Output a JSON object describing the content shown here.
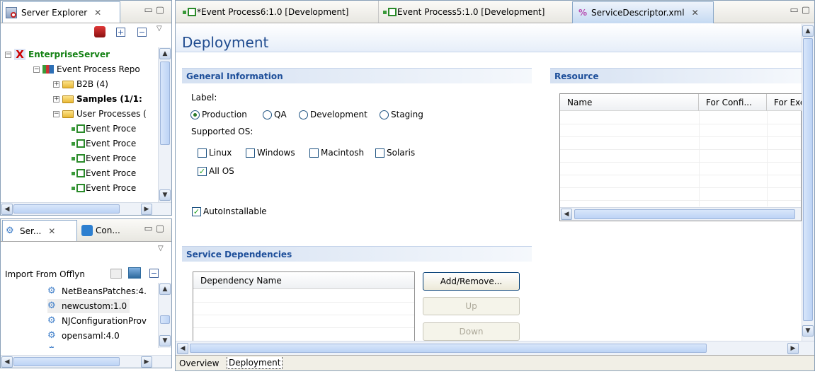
{
  "left_top_view": {
    "tab_label": "Server Explorer",
    "tree": [
      {
        "label": "EnterpriseServer",
        "kind": "server",
        "toggle": "−"
      },
      {
        "label": "Event Process Repo",
        "kind": "repo",
        "toggle": "−"
      },
      {
        "label": "B2B (4)",
        "kind": "folder",
        "toggle": "+"
      },
      {
        "label": "Samples (1/1:",
        "kind": "folder",
        "toggle": "+",
        "bold": true
      },
      {
        "label": "User Processes (",
        "kind": "folder",
        "toggle": "−"
      },
      {
        "label": "Event Proce",
        "kind": "process"
      },
      {
        "label": "Event Proce",
        "kind": "process"
      },
      {
        "label": "Event Proce",
        "kind": "process"
      },
      {
        "label": "Event Proce",
        "kind": "process"
      },
      {
        "label": "Event Proce",
        "kind": "process"
      }
    ]
  },
  "left_bottom_view": {
    "tabs": [
      "Ser...",
      "Con..."
    ],
    "import_label": "Import From Offlyn",
    "list": [
      "NetBeansPatches:4.",
      "newcustom:1.0",
      "NJConfigurationProv",
      "opensaml:4.0",
      "..."
    ]
  },
  "editor_tabs": [
    {
      "label": "*Event Process6:1.0 [Development]"
    },
    {
      "label": "Event Process5:1.0 [Development]"
    },
    {
      "label": "ServiceDescriptor.xml",
      "active": true
    }
  ],
  "page_title": "Deployment",
  "general": {
    "title": "General Information",
    "label_caption": "Label:",
    "radios": [
      {
        "label": "Production",
        "selected": true
      },
      {
        "label": "QA",
        "selected": false
      },
      {
        "label": "Development",
        "selected": false
      },
      {
        "label": "Staging",
        "selected": false
      }
    ],
    "os_caption": "Supported OS:",
    "os": [
      {
        "label": "Linux",
        "checked": false
      },
      {
        "label": "Windows",
        "checked": false
      },
      {
        "label": "Macintosh",
        "checked": false
      },
      {
        "label": "Solaris",
        "checked": false
      }
    ],
    "all_os": {
      "label": "All OS",
      "checked": true
    },
    "auto_installable": {
      "label": "AutoInstallable",
      "checked": true
    }
  },
  "resource": {
    "title": "Resource",
    "columns": [
      "Name",
      "For Confi...",
      "For Exe"
    ]
  },
  "dependencies": {
    "title": "Service Dependencies",
    "column": "Dependency Name",
    "buttons": {
      "add_remove": "Add/Remove...",
      "up": "Up",
      "down": "Down"
    }
  },
  "bottom_tabs": [
    "Overview",
    "Deployment"
  ]
}
